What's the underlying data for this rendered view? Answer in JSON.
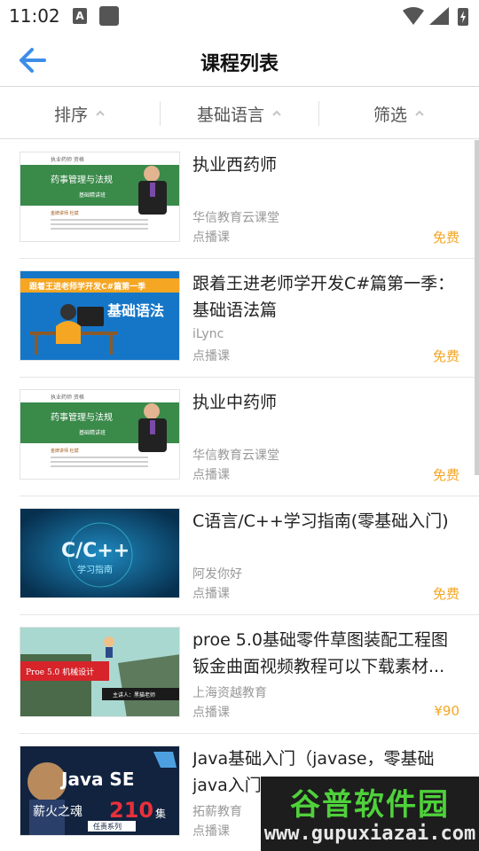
{
  "status_bar": {
    "time": "11:02",
    "icon_letter": "A"
  },
  "header": {
    "title": "课程列表"
  },
  "filters": [
    {
      "label": "排序"
    },
    {
      "label": "基础语言"
    },
    {
      "label": "筛选"
    }
  ],
  "courses": [
    {
      "title": "执业西药师",
      "org": "华信教育云课堂",
      "type": "点播课",
      "price": "免费",
      "thumb": {
        "kind": "pharma",
        "banner": "药事管理与法规",
        "sub": "基础精讲班",
        "top": "执业药师 资格",
        "foot": "金牌讲师 杜斌"
      }
    },
    {
      "title": "跟着王进老师学开发C#篇第一季：基础语法篇",
      "org": "iLync",
      "type": "点播课",
      "price": "免费",
      "thumb": {
        "kind": "csharp",
        "top": "跟着王进老师学开发C#篇第一季",
        "main": "基础语法"
      }
    },
    {
      "title": "执业中药师",
      "org": "华信教育云课堂",
      "type": "点播课",
      "price": "免费",
      "thumb": {
        "kind": "pharma",
        "banner": "药事管理与法规",
        "sub": "基础精讲班",
        "top": "执业药师 资格",
        "foot": "金牌讲师 杜斌"
      }
    },
    {
      "title": "C语言/C++学习指南(零基础入门)",
      "org": "阿发你好",
      "type": "点播课",
      "price": "免费",
      "thumb": {
        "kind": "cpp",
        "main": "C/C++",
        "sub": "学习指南"
      }
    },
    {
      "title": "proe 5.0基础零件草图装配工程图钣金曲面视频教程可以下载素材...",
      "org": "上海资越教育",
      "type": "点播课",
      "price": "¥90",
      "thumb": {
        "kind": "proe",
        "label": "Proe 5.0 机械设计",
        "speaker": "主讲人：黑猫老师"
      }
    },
    {
      "title": "Java基础入门（javase，零基础java入门教程入门）",
      "org": "拓薪教育",
      "type": "点播课",
      "price": "",
      "thumb": {
        "kind": "java",
        "main": "Java SE",
        "sub": "薪火之魂",
        "num": "210",
        "unit": "集",
        "tag": "任责系列"
      }
    }
  ],
  "watermark": {
    "cn": "谷普软件园",
    "url": "www.gupuxiazai.com"
  },
  "colors": {
    "accent": "#3d8de8",
    "price": "#f5a623",
    "watermark_green": "#4fd13b"
  }
}
